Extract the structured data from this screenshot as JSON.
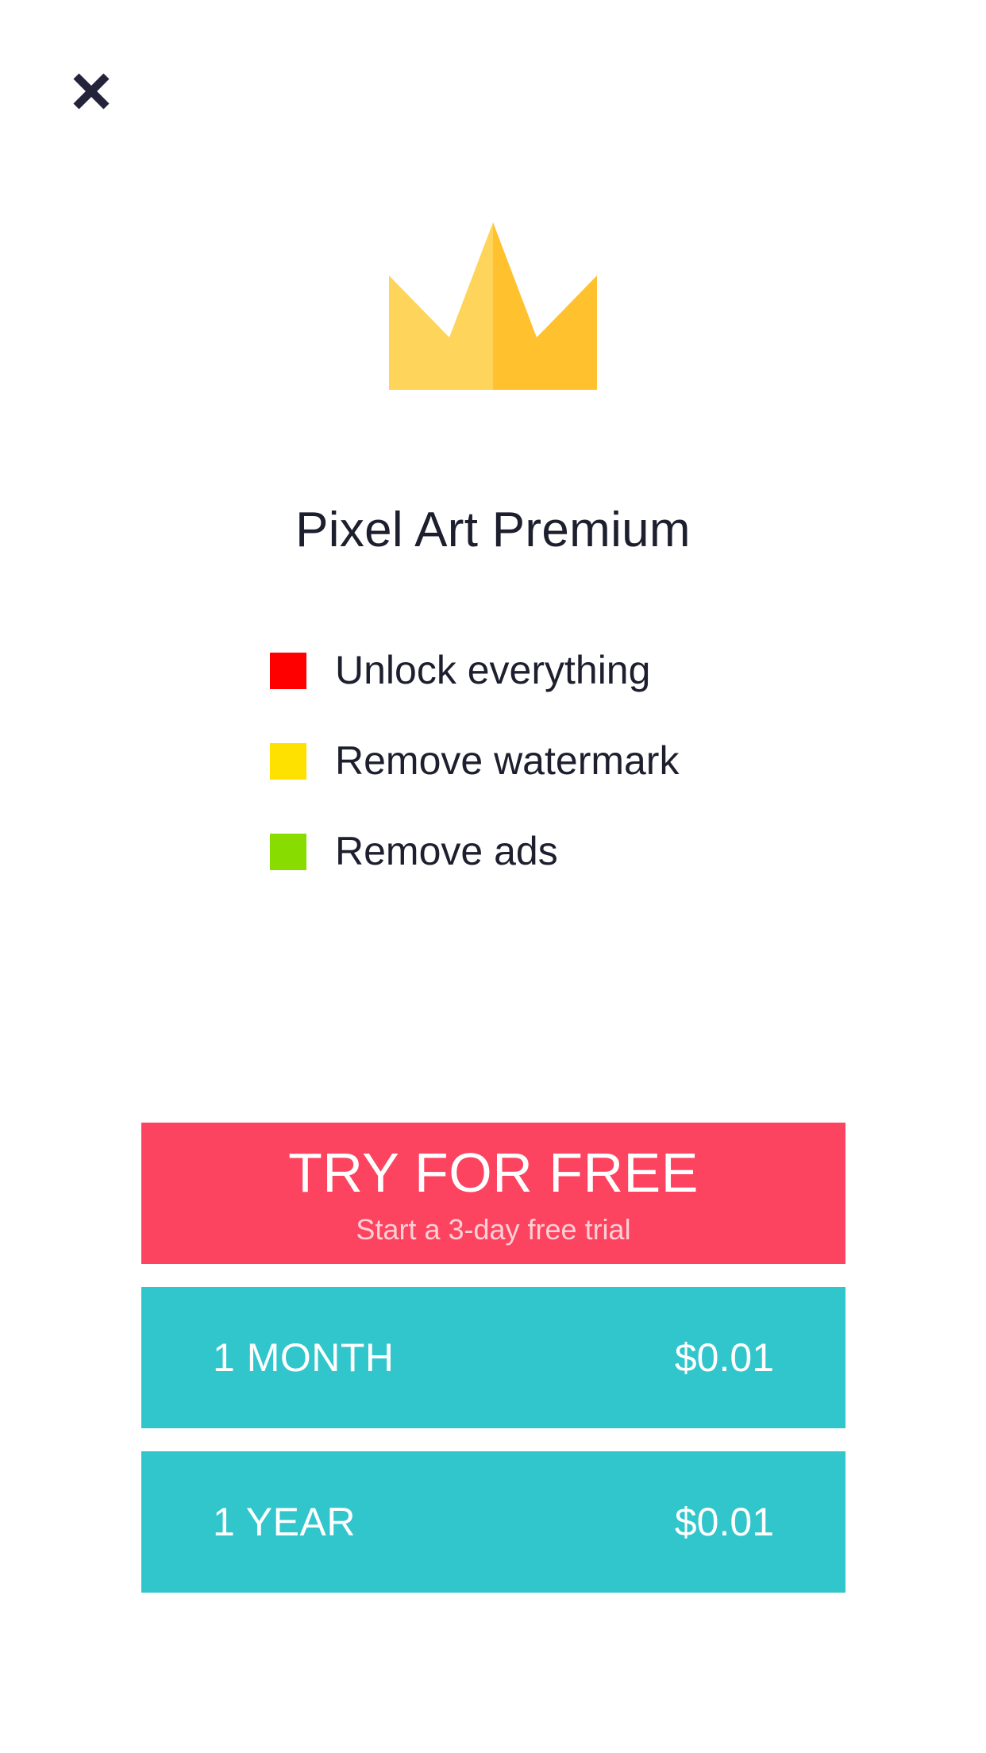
{
  "header": {
    "close_icon": "close-icon"
  },
  "hero": {
    "icon": "crown-icon",
    "colors": {
      "crown_light": "#FFD45A",
      "crown_dark": "#FFC12E"
    }
  },
  "title": "Pixel Art Premium",
  "features": [
    {
      "label": "Unlock everything",
      "color": "#FF0000"
    },
    {
      "label": "Remove watermark",
      "color": "#FFE100"
    },
    {
      "label": "Remove ads",
      "color": "#88DC00"
    }
  ],
  "trial": {
    "title": "TRY FOR FREE",
    "subtitle": "Start a 3-day free trial",
    "color": "#FC4460"
  },
  "plans": [
    {
      "name": "1 MONTH",
      "price": "$0.01"
    },
    {
      "name": "1 YEAR",
      "price": "$0.01"
    }
  ],
  "plan_color": "#31C5CC"
}
